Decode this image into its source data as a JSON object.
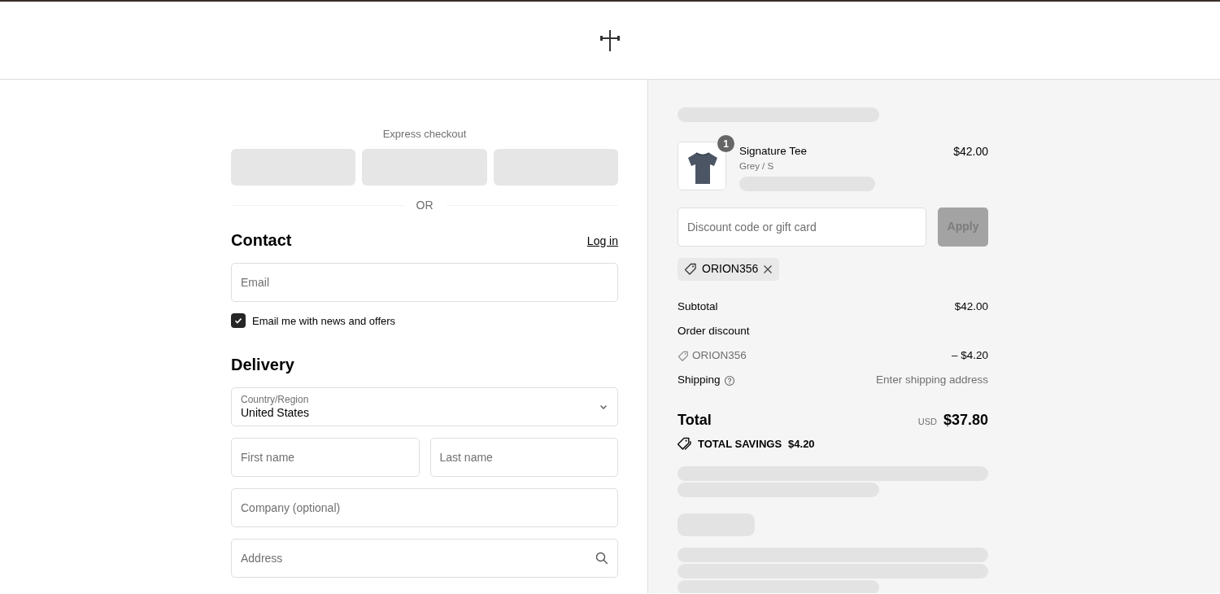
{
  "express_checkout": {
    "label": "Express checkout",
    "divider": "OR"
  },
  "contact": {
    "heading": "Contact",
    "login_link": "Log in",
    "email": {
      "placeholder": "Email"
    },
    "newsletter": {
      "label": "Email me with news and offers",
      "checked": true
    }
  },
  "delivery": {
    "heading": "Delivery",
    "country": {
      "label": "Country/Region",
      "value": "United States"
    },
    "rows": [
      [
        {
          "placeholder": "First name",
          "kind": "plain"
        },
        {
          "placeholder": "Last name",
          "kind": "plain"
        }
      ],
      [
        {
          "placeholder": "Company (optional)",
          "kind": "plain"
        }
      ],
      [
        {
          "placeholder": "Address",
          "kind": "search"
        }
      ]
    ]
  },
  "summary": {
    "items": [
      {
        "name": "Signature Tee",
        "variant": "Grey / S",
        "price": "$42.00",
        "quantity": "1"
      }
    ],
    "discount": {
      "placeholder": "Discount code or gift card",
      "button": "Apply",
      "disabled": true
    },
    "applied_codes": [
      "ORION356"
    ],
    "lines": [
      {
        "kind": "amount",
        "label": "Subtotal",
        "value": "$42.00"
      },
      {
        "kind": "heading",
        "label": "Order discount"
      },
      {
        "kind": "code",
        "label": "ORION356",
        "value": "– $4.20"
      },
      {
        "kind": "hint",
        "label": "Shipping",
        "value": "Enter shipping address"
      }
    ],
    "total": {
      "label": "Total",
      "currency": "USD",
      "value": "$37.80"
    },
    "savings": {
      "label": "TOTAL SAVINGS",
      "value": "$4.20"
    }
  }
}
